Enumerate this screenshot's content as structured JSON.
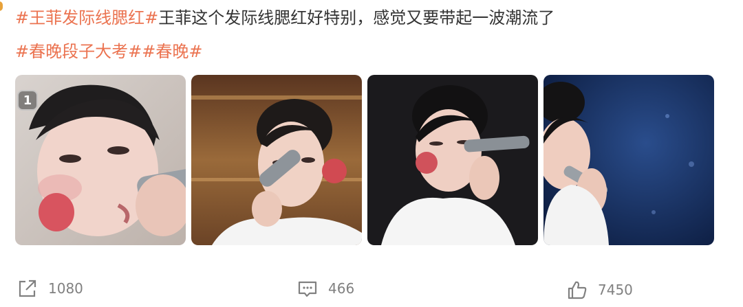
{
  "post": {
    "line1": {
      "tag": "#王菲发际线腮红#",
      "text": "王菲这个发际线腮红好特别，感觉又要带起一波潮流了"
    },
    "line2": {
      "tags": [
        "#春晚段子大考#",
        "#春晚#"
      ]
    }
  },
  "images": {
    "first_badge": "1",
    "items": [
      {
        "icon": "photo-thumbnail"
      },
      {
        "icon": "photo-thumbnail"
      },
      {
        "icon": "photo-thumbnail"
      },
      {
        "icon": "photo-thumbnail"
      }
    ]
  },
  "actions": {
    "share": {
      "icon": "share-icon",
      "count": "1080"
    },
    "comment": {
      "icon": "comment-icon",
      "count": "466"
    },
    "like": {
      "icon": "thumbs-up-icon",
      "count": "7450"
    }
  },
  "colors": {
    "tag": "#eb7350",
    "text": "#333333",
    "muted": "#808080"
  }
}
